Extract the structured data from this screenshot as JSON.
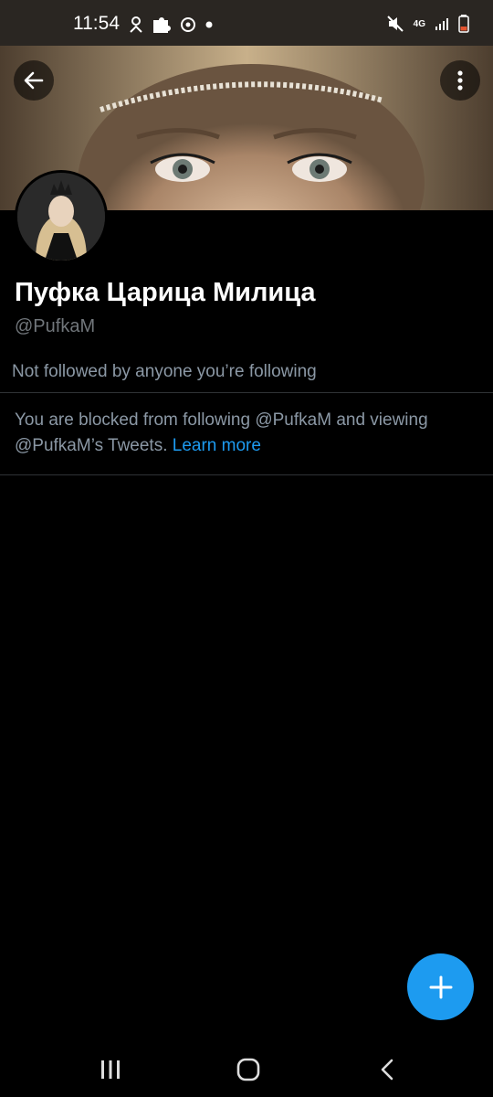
{
  "status_bar": {
    "time": "11:54",
    "network": "4G",
    "left_icons": [
      "weather-icon",
      "puzzle-icon",
      "sync-icon",
      "dot-icon"
    ],
    "right_icons": [
      "mute-icon",
      "signal-icon",
      "battery-icon"
    ]
  },
  "profile": {
    "name": "Пуфка Царица Милица",
    "handle": "@PufkaM",
    "followers_note": "Not followed by anyone you’re following"
  },
  "blocked": {
    "message": "You are blocked from following @PufkaM and viewing @PufkaM’s Tweets.",
    "link": "Learn more"
  },
  "colors": {
    "accent": "#1d9bf0",
    "background": "#000000",
    "secondary_text": "#8b98a5"
  }
}
